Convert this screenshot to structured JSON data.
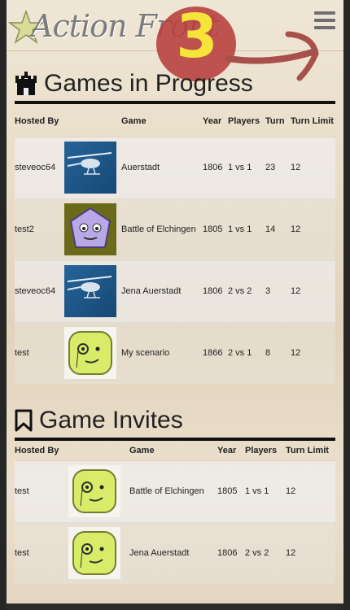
{
  "header": {
    "logo_text": "Action Front",
    "badge_number": "3",
    "menu_icon": "hamburger-menu-icon"
  },
  "games_in_progress": {
    "title": "Games in Progress",
    "icon": "castle-icon",
    "columns": [
      "Hosted By",
      "",
      "Game",
      "Year",
      "Players",
      "Turn",
      "Turn Limit"
    ],
    "rows": [
      {
        "host": "steveoc64",
        "avatar": "helicopter-avatar",
        "game": "Auerstadt",
        "year": "1806",
        "players": "1 vs 1",
        "turn": "23",
        "limit": "12"
      },
      {
        "host": "test2",
        "avatar": "purple-face-avatar",
        "game": "Battle of Elchingen",
        "year": "1805",
        "players": "1 vs 1",
        "turn": "14",
        "limit": "12"
      },
      {
        "host": "steveoc64",
        "avatar": "helicopter-avatar",
        "game": "Jena Auerstadt",
        "year": "1806",
        "players": "2 vs 2",
        "turn": "3",
        "limit": "12"
      },
      {
        "host": "test",
        "avatar": "monocle-face-avatar",
        "game": "My scenario",
        "year": "1866",
        "players": "2 vs 1",
        "turn": "8",
        "limit": "12"
      }
    ]
  },
  "game_invites": {
    "title": "Game Invites",
    "icon": "bookmark-icon",
    "columns": [
      "Hosted By",
      "",
      "Game",
      "Year",
      "Players",
      "Turn Limit"
    ],
    "rows": [
      {
        "host": "test",
        "avatar": "monocle-face-avatar",
        "game": "Battle of Elchingen",
        "year": "1805",
        "players": "1 vs 1",
        "limit": "12"
      },
      {
        "host": "test",
        "avatar": "monocle-face-avatar",
        "game": "Jena Auerstadt",
        "year": "1806",
        "players": "2 vs 2",
        "limit": "12"
      }
    ]
  },
  "colors": {
    "badge": "#b8413f",
    "badge_number": "#f6e43b",
    "rule": "#111111"
  }
}
